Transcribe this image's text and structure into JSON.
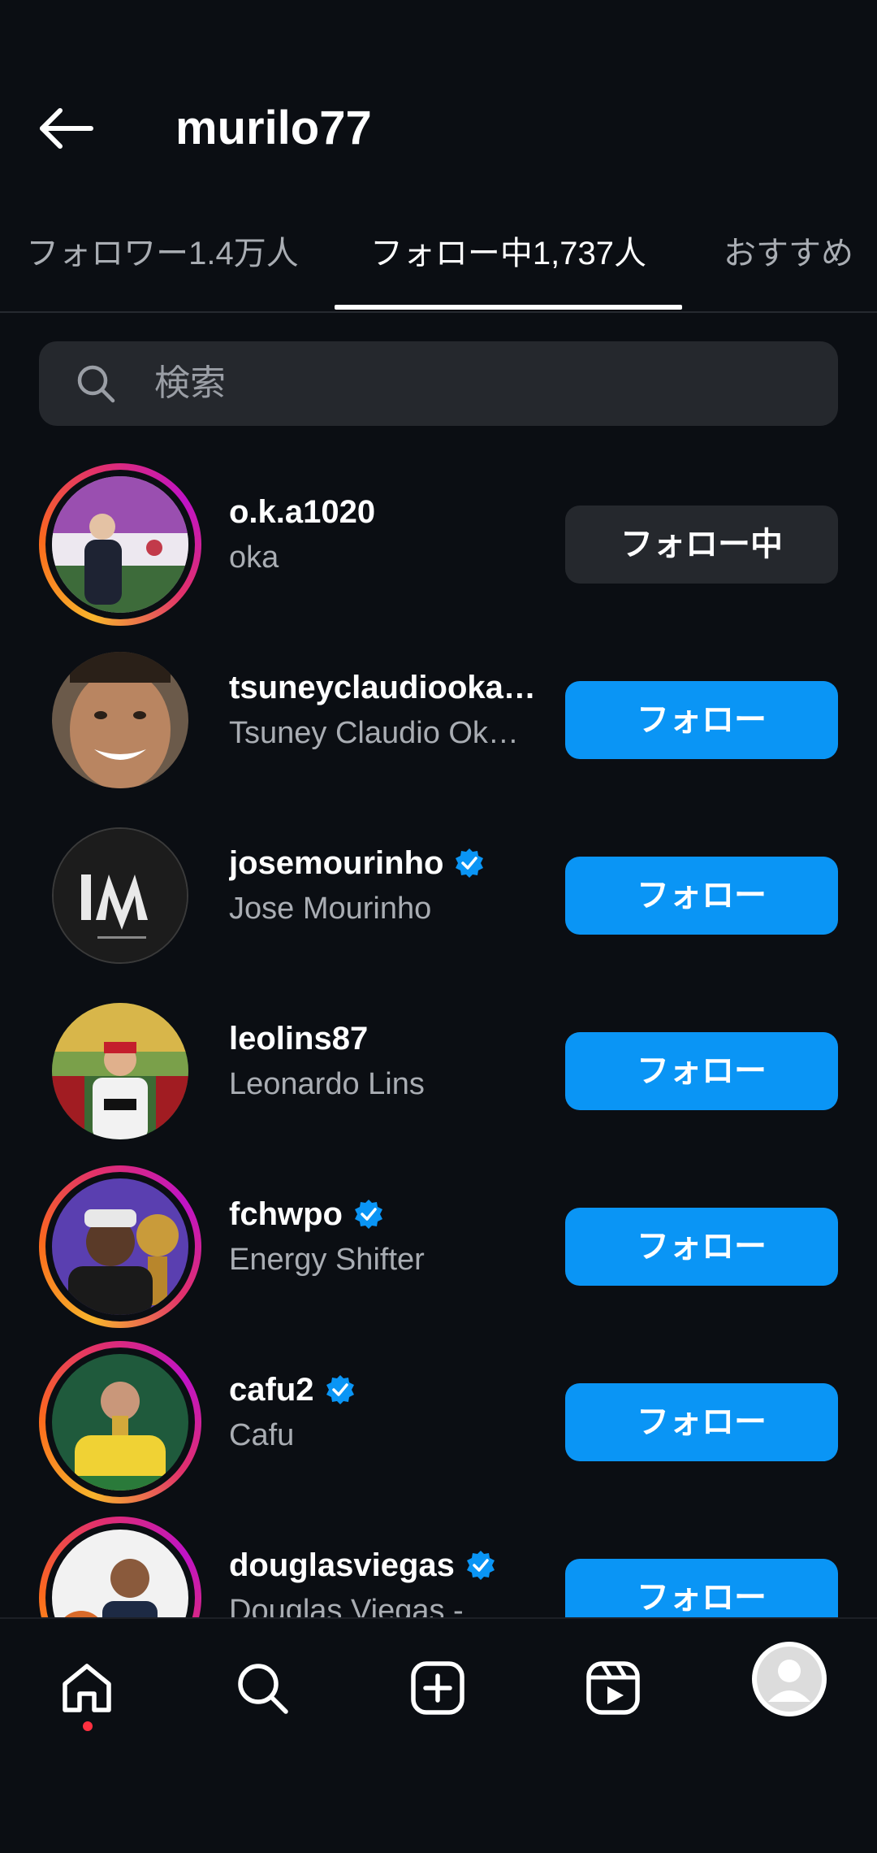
{
  "header": {
    "title": "murilo77"
  },
  "tabs": [
    {
      "label": "フォロワー1.4万人",
      "active": false
    },
    {
      "label": "フォロー中1,737人",
      "active": true
    },
    {
      "label": "おすすめ",
      "active": false
    }
  ],
  "search": {
    "placeholder": "検索"
  },
  "users": [
    {
      "username": "o.k.a1020",
      "fullname": "oka",
      "verified": false,
      "button": "フォロー中",
      "story": true
    },
    {
      "username": "tsuneyclaudiookas…",
      "fullname": "Tsuney Claudio Ok…",
      "verified": false,
      "button": "フォロー",
      "story": false
    },
    {
      "username": "josemourinho",
      "fullname": "Jose Mourinho",
      "verified": true,
      "button": "フォロー",
      "story": false
    },
    {
      "username": "leolins87",
      "fullname": "Leonardo Lins",
      "verified": false,
      "button": "フォロー",
      "story": false
    },
    {
      "username": "fchwpo",
      "fullname": "Energy Shifter",
      "verified": true,
      "button": "フォロー",
      "story": true
    },
    {
      "username": "cafu2",
      "fullname": "Cafu",
      "verified": true,
      "button": "フォロー",
      "story": true
    },
    {
      "username": "douglasviegas",
      "fullname": "Douglas Viegas -",
      "verified": true,
      "button": "フォロー",
      "story": true
    }
  ],
  "nav": [
    {
      "icon": "home-icon"
    },
    {
      "icon": "search-icon"
    },
    {
      "icon": "create-icon"
    },
    {
      "icon": "reels-icon"
    },
    {
      "icon": "profile-avatar"
    }
  ],
  "colors": {
    "background": "#0b0e13",
    "follow_button": "#0a95f5",
    "following_button": "#25282d",
    "verified_badge": "#0a95f5",
    "notification_dot": "#ff3040"
  }
}
